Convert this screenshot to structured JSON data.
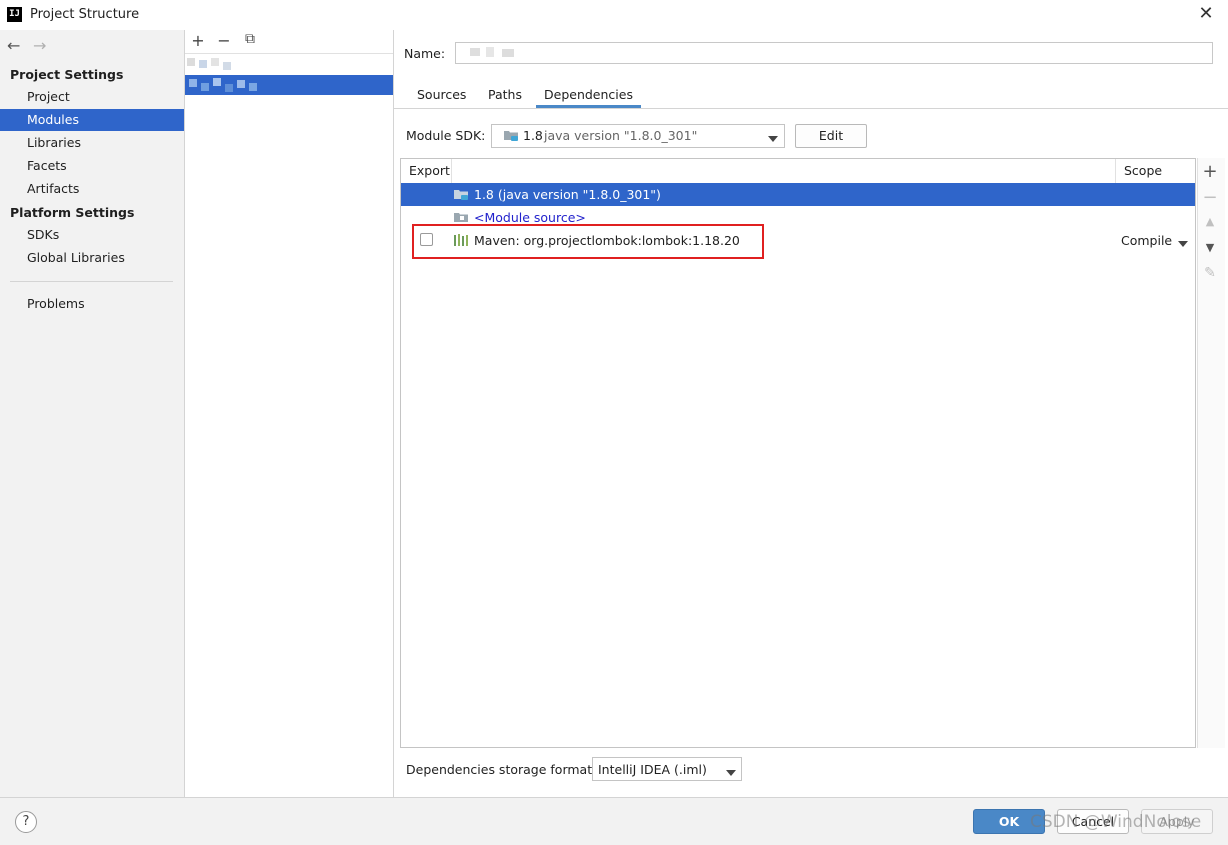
{
  "window": {
    "title": "Project Structure",
    "icon_text": "IJ",
    "close_glyph": "✕"
  },
  "nav": {
    "back": "←",
    "forward": "→"
  },
  "sidebar": {
    "project_settings_header": "Project Settings",
    "project_settings_items": [
      "Project",
      "Modules",
      "Libraries",
      "Facets",
      "Artifacts"
    ],
    "platform_settings_header": "Platform Settings",
    "platform_settings_items": [
      "SDKs",
      "Global Libraries"
    ],
    "problems": "Problems",
    "selected": "Modules"
  },
  "module_toolbar": {
    "add": "+",
    "remove": "−",
    "copy": "⧉"
  },
  "module": {
    "name_label": "Name:",
    "name_value": ""
  },
  "tabs": [
    "Sources",
    "Paths",
    "Dependencies"
  ],
  "selected_tab": "Dependencies",
  "sdk": {
    "label": "Module SDK:",
    "version_bold": "1.8",
    "version_detail": " java version \"1.8.0_301\"",
    "edit_button": "Edit"
  },
  "dependencies_table": {
    "columns": {
      "export": "Export",
      "scope": "Scope"
    },
    "rows": [
      {
        "name": "1.8 (java version \"1.8.0_301\")",
        "icon": "jdk-folder-icon",
        "selected": true,
        "has_checkbox": false,
        "scope": ""
      },
      {
        "name": "<Module source>",
        "icon": "module-source-folder-icon",
        "selected": false,
        "has_checkbox": false,
        "scope": ""
      },
      {
        "name": "Maven: org.projectlombok:lombok:1.18.20",
        "icon": "library-icon",
        "selected": false,
        "has_checkbox": true,
        "scope": "Compile"
      }
    ]
  },
  "side_tools": {
    "add": "+",
    "remove": "−",
    "up": "▲",
    "down": "▼",
    "edit": "✎"
  },
  "storage": {
    "label": "Dependencies storage format:",
    "value": "IntelliJ IDEA (.iml)"
  },
  "buttons": {
    "ok": "OK",
    "cancel": "Cancel",
    "apply": "Apply",
    "help": "?"
  },
  "watermark": "CSDN @WindNolose",
  "colors": {
    "selection": "#2f65ca",
    "accent": "#4a88c7",
    "highlight_box": "#e02020",
    "link": "#2222cc"
  }
}
